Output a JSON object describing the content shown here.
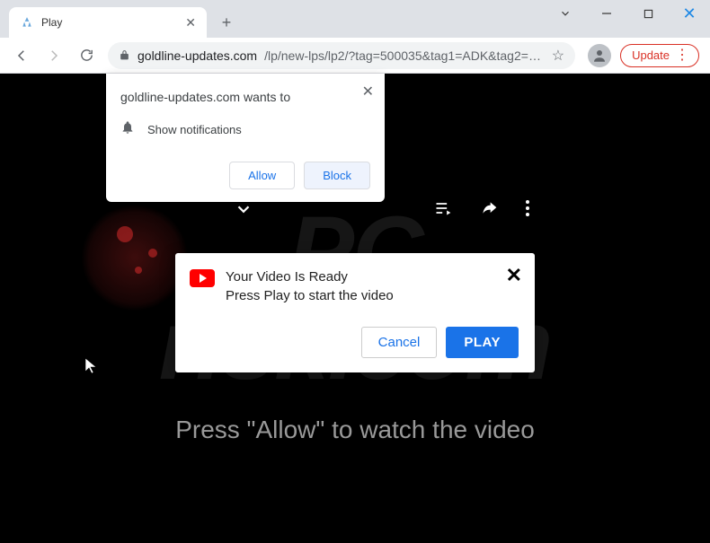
{
  "window": {
    "tab_title": "Play",
    "update_label": "Update"
  },
  "address": {
    "host": "goldline-updates.com",
    "path": "/lp/new-lps/lp2/?tag=500035&tag1=ADK&tag2=be..."
  },
  "permission": {
    "title": "goldline-updates.com wants to",
    "item": "Show notifications",
    "allow": "Allow",
    "block": "Block"
  },
  "video_dialog": {
    "line1": "Your Video Is Ready",
    "line2": "Press Play to start the video",
    "cancel": "Cancel",
    "play": "PLAY"
  },
  "page": {
    "instruction": "Press \"Allow\" to watch the video"
  },
  "watermark": {
    "line1": "PC",
    "line2": "risk.com"
  }
}
